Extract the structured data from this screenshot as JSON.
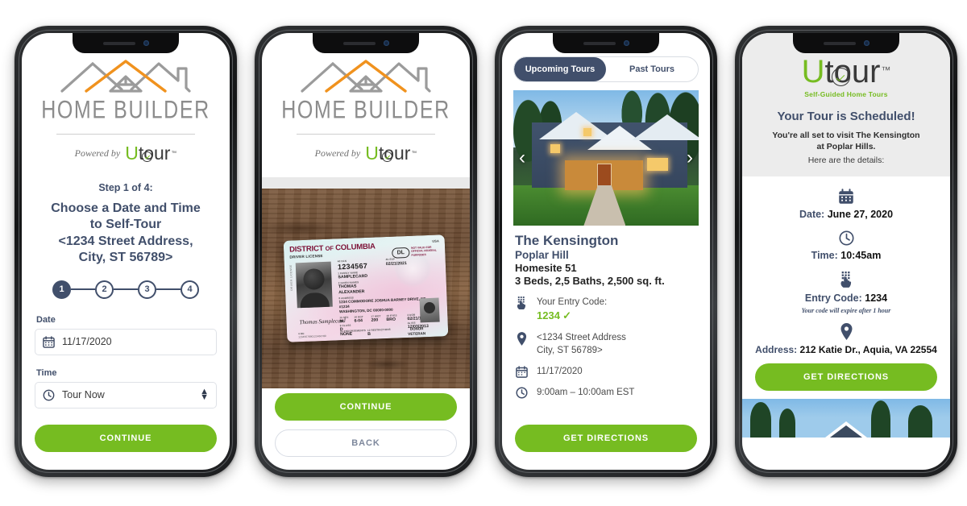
{
  "brand": {
    "green": "#76bc21",
    "navy": "#414f6b",
    "orange": "#f0921e",
    "gray": "#8c8c8c",
    "home_builder_title": "HOME BUILDER",
    "powered_by": "Powered by",
    "utour_u": "U",
    "utour_tour": "tour",
    "utour_tm": "™",
    "utour_tagline": "Self-Guided Home Tours"
  },
  "phone1": {
    "step_label": "Step 1 of 4:",
    "heading_line1": "Choose a Date and Time",
    "heading_line2": "to Self-Tour",
    "heading_line3": "<1234 Street Address,",
    "heading_line4": "City, ST 56789>",
    "steps": [
      {
        "num": "1",
        "active": true
      },
      {
        "num": "2",
        "active": false
      },
      {
        "num": "3",
        "active": false
      },
      {
        "num": "4",
        "active": false
      }
    ],
    "date_label": "Date",
    "date_value": "11/17/2020",
    "date_icon": "calendar-icon",
    "time_label": "Time",
    "time_value": "Tour Now",
    "time_icon": "clock-icon",
    "continue_label": "CONTINUE"
  },
  "phone2": {
    "license": {
      "state": "DISTRICT",
      "of": "OF",
      "state2": "COLUMBIA",
      "doc_type": "DRIVER LICENSE",
      "usa": "USA",
      "dl_badge": "DL",
      "not_valid": "NOT VALID FOR OFFICIAL FEDERAL PURPOSES",
      "dln_label": "4d DLN",
      "dln_value": "1234567",
      "exp_label": "4b EXP",
      "exp_value": "02/21/2021",
      "last_label": "1 FAMILY NAME",
      "last_value": "SAMPLECARD",
      "first_label": "2 GIVEN NAMES",
      "first_value_1": "THOMAS",
      "first_value_2": "ALEXANDER",
      "addr_label": "8 ADDRESS",
      "addr_1": "1234 COMMODORE JOSHUA BARNEY DRIVE, NE",
      "addr_2": "#1234",
      "addr_3": "WASHINGTON, DC 00000-0000",
      "sex_label": "15 SEX",
      "sex_value": "M",
      "hgt_label": "16 HGT",
      "hgt_value": "6-04",
      "wgt_label": "17 WGT",
      "wgt_value": "200",
      "eyes_label": "18 EYES",
      "eyes_value": "BRO",
      "dob_label": "3 DOB",
      "dob_value": "02/21/1964",
      "class_label": "9 CLASS",
      "class_value": "D",
      "iss_label": "4a ISS",
      "iss_value": "12/03/2013",
      "end_label": "9a ENDORSEMENTS",
      "end_value": "NONE",
      "rest_label": "12 RESTRICTIONS",
      "rest_value": "B",
      "donor": "DONOR",
      "veteran": "VETERAN",
      "barcode_label": "4 DD",
      "barcode_value": "1234567890123456789",
      "signature": "Thomas Samplecard"
    },
    "continue_label": "CONTINUE",
    "back_label": "BACK"
  },
  "phone3": {
    "tabs": [
      {
        "label": "Upcoming Tours",
        "active": true
      },
      {
        "label": "Past Tours",
        "active": false
      }
    ],
    "prev_arrow": "‹",
    "next_arrow": "›",
    "title": "The Kensington",
    "community": "Poplar Hill",
    "homesite": "Homesite 51",
    "specs": "3 Beds, 2,5 Baths, 2,500 sq. ft.",
    "entry_code_label": "Your Entry Code:",
    "entry_code_value": "1234",
    "entry_code_check": "✓",
    "address_line1": "<1234 Street Address",
    "address_line2": "City, ST 56789>",
    "date": "11/17/2020",
    "time": "9:00am – 10:00am EST",
    "get_directions_label": "GET DIRECTIONS",
    "keypad_icon": "keypad-hand-icon",
    "pin_icon": "map-pin-icon",
    "calendar_icon": "calendar-icon",
    "clock_icon": "clock-icon"
  },
  "phone4": {
    "heading": "Your Tour is Scheduled!",
    "intro_line1": "You're all set to visit The Kensington",
    "intro_line2": "at Poplar Hills.",
    "intro_line3": "Here are the details:",
    "date_label": "Date:",
    "date_value": "June 27, 2020",
    "time_label": "Time:",
    "time_value": "10:45am",
    "entry_label": "Entry Code:",
    "entry_value": "1234",
    "entry_note": "Your code will expire after 1 hour",
    "address_label": "Address:",
    "address_value": "212 Katie Dr., Aquia, VA 22554",
    "get_directions_label": "GET DIRECTIONS",
    "calendar_icon": "calendar-icon",
    "clock_icon": "clock-icon",
    "keypad_icon": "keypad-hand-icon",
    "pin_icon": "map-pin-icon"
  }
}
